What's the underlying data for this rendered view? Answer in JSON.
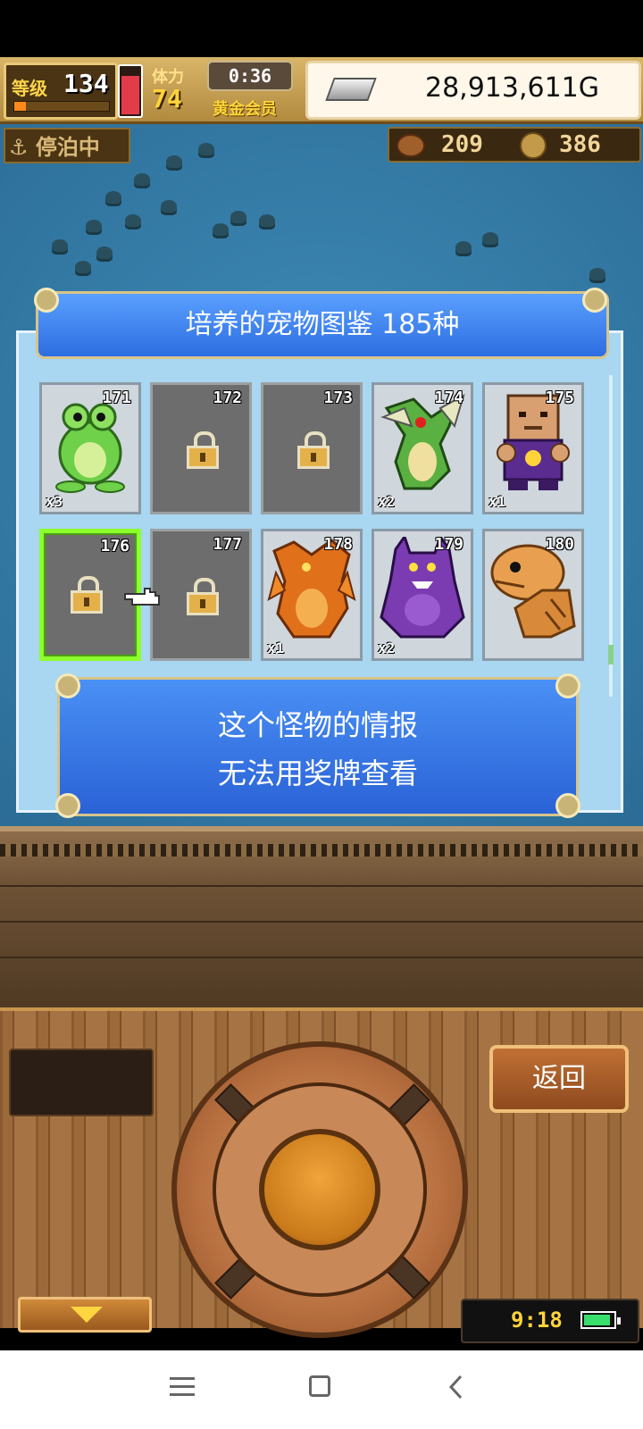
{
  "hud": {
    "level_label": "等级",
    "level": "134",
    "level_xp_fraction": 0.12,
    "hp_fraction": 0.9,
    "stamina_label": "体力",
    "stamina": "74",
    "timer": "0:36",
    "membership": "黄金会员",
    "gold": "28,913,611G",
    "status": "停泊中",
    "resource1": "209",
    "resource2": "386"
  },
  "dialog": {
    "title": "培养的宠物图鉴  185种",
    "cards": [
      {
        "number": "171",
        "locked": false,
        "count": "x3",
        "monster": "frog"
      },
      {
        "number": "172",
        "locked": true
      },
      {
        "number": "173",
        "locked": true
      },
      {
        "number": "174",
        "locked": false,
        "count": "x2",
        "monster": "dragon-green"
      },
      {
        "number": "175",
        "locked": false,
        "count": "x1",
        "monster": "block-golem"
      },
      {
        "number": "176",
        "locked": true,
        "selected": true
      },
      {
        "number": "177",
        "locked": true
      },
      {
        "number": "178",
        "locked": false,
        "count": "x1",
        "monster": "dragon-orange"
      },
      {
        "number": "179",
        "locked": false,
        "count": "x2",
        "monster": "demon-purple"
      },
      {
        "number": "180",
        "locked": false,
        "count": "",
        "monster": "beast-orange"
      }
    ],
    "info_line1": "这个怪物的情报",
    "info_line2": "无法用奖牌查看"
  },
  "controls": {
    "back_label": "返回",
    "clock": "9:18",
    "battery_fraction": 0.9
  },
  "colors": {
    "title_blue": "#3b7df0",
    "selected_border": "#8cff2c",
    "gold_text": "#ffd43a"
  }
}
